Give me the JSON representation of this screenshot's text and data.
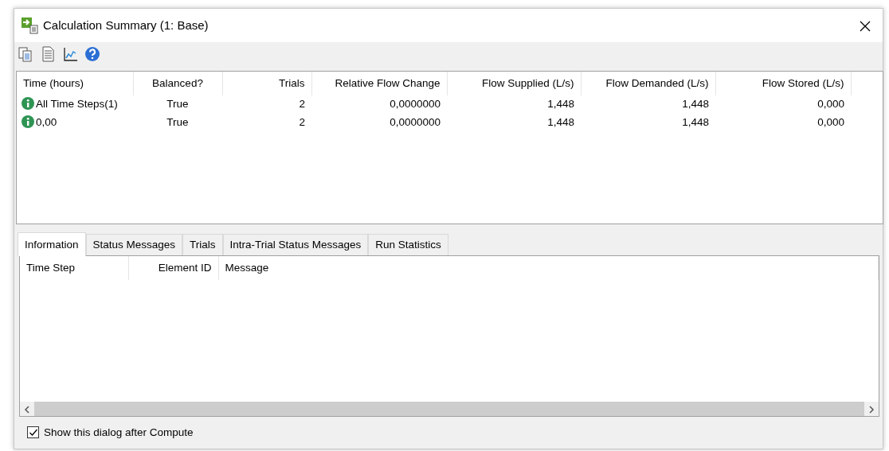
{
  "window": {
    "title": "Calculation Summary (1: Base)"
  },
  "toolbar": [
    {
      "kind": "copy"
    },
    {
      "kind": "report"
    },
    {
      "kind": "graph"
    },
    {
      "kind": "help"
    }
  ],
  "summary_table": {
    "columns": [
      {
        "label": "Time (hours)"
      },
      {
        "label": "Balanced?"
      },
      {
        "label": "Trials"
      },
      {
        "label": "Relative Flow Change"
      },
      {
        "label": "Flow Supplied (L/s)"
      },
      {
        "label": "Flow Demanded (L/s)"
      },
      {
        "label": "Flow Stored (L/s)"
      }
    ],
    "rows": [
      {
        "cells": [
          "All Time Steps(1)",
          "True",
          "2",
          "0,0000000",
          "1,448",
          "1,448",
          "0,000"
        ]
      },
      {
        "cells": [
          "0,00",
          "True",
          "2",
          "0,0000000",
          "1,448",
          "1,448",
          "0,000"
        ]
      }
    ]
  },
  "tabs": [
    {
      "label": "Information",
      "selected": true
    },
    {
      "label": "Status Messages",
      "selected": false
    },
    {
      "label": "Trials",
      "selected": false
    },
    {
      "label": "Intra-Trial Status Messages",
      "selected": false
    },
    {
      "label": "Run Statistics",
      "selected": false
    }
  ],
  "message_table": {
    "columns": [
      {
        "label": "Time Step"
      },
      {
        "label": "Element ID"
      },
      {
        "label": "Message"
      }
    ]
  },
  "show_after_compute": {
    "label": "Show this dialog after Compute",
    "checked": true
  }
}
